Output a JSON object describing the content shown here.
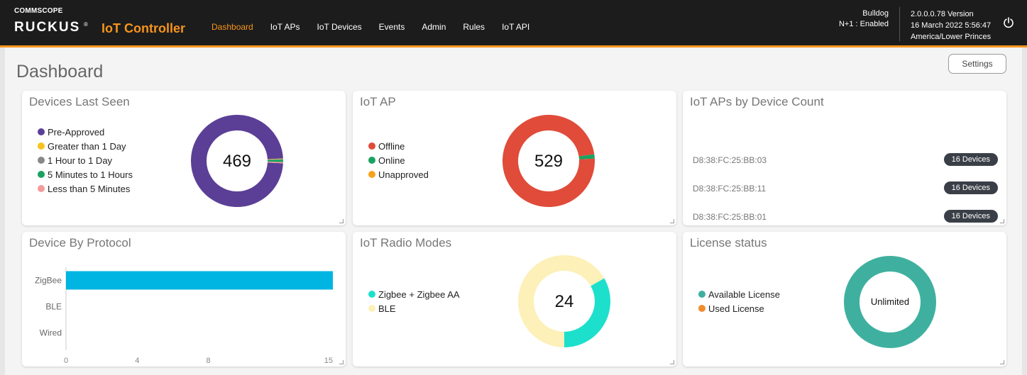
{
  "brand": {
    "company": "COMMSCOPE",
    "product_line": "RUCKUS",
    "registered": "®",
    "product": "IoT Controller"
  },
  "nav": [
    {
      "label": "Dashboard",
      "active": true
    },
    {
      "label": "IoT APs",
      "active": false
    },
    {
      "label": "IoT Devices",
      "active": false
    },
    {
      "label": "Events",
      "active": false
    },
    {
      "label": "Admin",
      "active": false
    },
    {
      "label": "Rules",
      "active": false
    },
    {
      "label": "IoT API",
      "active": false
    }
  ],
  "system": {
    "name": "Bulldog",
    "redundancy": "N+1 : Enabled",
    "version": "2.0.0.0.78 Version",
    "datetime": "16 March 2022 5:56:47",
    "timezone": "America/Lower Princes",
    "power_icon": "power-icon"
  },
  "page": {
    "title": "Dashboard",
    "settings_label": "Settings"
  },
  "colors": {
    "accent": "#f7941d",
    "topbar": "#1c1c1c",
    "badge": "#3a3f47"
  },
  "devices_last_seen": {
    "title": "Devices Last Seen",
    "total": "469",
    "legend": [
      {
        "label": "Pre-Approved",
        "color": "#5b3f96",
        "value": 461
      },
      {
        "label": "Greater than 1 Day",
        "color": "#f7c31d",
        "value": 1
      },
      {
        "label": "1 Hour to 1 Day",
        "color": "#888888",
        "value": 1
      },
      {
        "label": "5 Minutes to 1 Hours",
        "color": "#1aa260",
        "value": 4
      },
      {
        "label": "Less than 5 Minutes",
        "color": "#f49a9a",
        "value": 2
      }
    ]
  },
  "iot_ap": {
    "title": "IoT AP",
    "total": "529",
    "legend": [
      {
        "label": "Offline",
        "color": "#e04b3a",
        "value": 521
      },
      {
        "label": "Online",
        "color": "#1aa260",
        "value": 8
      },
      {
        "label": "Unapproved",
        "color": "#f7a21d",
        "value": 0
      }
    ]
  },
  "aps_by_device_count": {
    "title": "IoT APs by Device Count",
    "rows": [
      {
        "mac": "D8:38:FC:25:BB:03",
        "count": "16 Devices"
      },
      {
        "mac": "D8:38:FC:25:BB:11",
        "count": "16 Devices"
      },
      {
        "mac": "D8:38:FC:25:BB:01",
        "count": "16 Devices"
      }
    ]
  },
  "device_by_protocol": {
    "title": "Device By Protocol"
  },
  "chart_data": {
    "type": "bar",
    "orientation": "horizontal",
    "categories": [
      "ZigBee",
      "BLE",
      "Wired"
    ],
    "values": [
      15,
      0,
      0
    ],
    "xlim": [
      0,
      15
    ],
    "xticks": [
      "0",
      "4",
      "8",
      "15"
    ],
    "xtick_values": [
      0,
      4,
      8,
      15
    ],
    "color": "#00b5e2",
    "title": "",
    "xlabel": "",
    "ylabel": ""
  },
  "radio_modes": {
    "title": "IoT Radio Modes",
    "total": "24",
    "legend": [
      {
        "label": "Zigbee + Zigbee AA",
        "color": "#1de0cc",
        "value": 8
      },
      {
        "label": "BLE",
        "color": "#fdf0b8",
        "value": 16
      }
    ]
  },
  "license": {
    "title": "License status",
    "center": "Unlimited",
    "legend": [
      {
        "label": "Available License",
        "color": "#3fb09f",
        "value": 100
      },
      {
        "label": "Used License",
        "color": "#f08c2d",
        "value": 0
      }
    ]
  }
}
